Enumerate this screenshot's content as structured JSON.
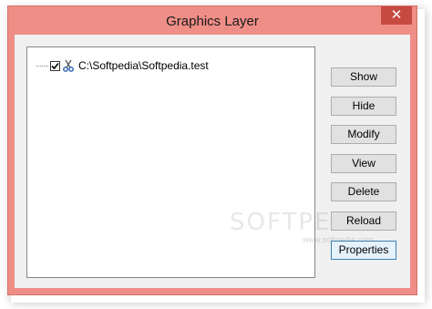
{
  "window": {
    "title": "Graphics Layer",
    "close_glyph": "✕"
  },
  "tree": {
    "items": [
      {
        "label": "C:\\Softpedia\\Softpedia.test",
        "checked": true,
        "icon": "scissors-icon"
      }
    ]
  },
  "buttons": {
    "show": "Show",
    "hide": "Hide",
    "modify": "Modify",
    "view": "View",
    "delete": "Delete",
    "reload": "Reload",
    "properties": "Properties"
  },
  "watermark": {
    "main": "SOFTPEDIA",
    "sub": "www.softpedia.com"
  },
  "colors": {
    "frame": "#ef8e87",
    "close_button": "#c74a40",
    "client_bg": "#f0f0f0",
    "default_button_border": "#3c7fb1"
  }
}
